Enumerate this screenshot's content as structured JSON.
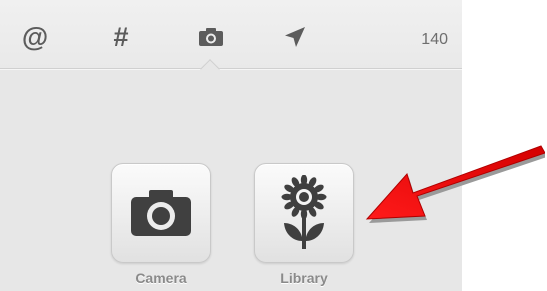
{
  "toolbar": {
    "mention_symbol": "@",
    "hashtag_symbol": "#",
    "camera_icon": "camera-icon",
    "location_icon": "location-arrow-icon",
    "char_count": "140"
  },
  "attach": {
    "camera_label": "Camera",
    "library_label": "Library",
    "camera_icon": "camera-icon",
    "library_icon": "flower-icon"
  },
  "annotation": {
    "arrow_color": "#e60000",
    "arrow_icon": "red-arrow"
  },
  "colors": {
    "panel_bg": "#e7e7e7",
    "icon_gray": "#5c5c5c",
    "label_gray": "#8a8a8a"
  }
}
